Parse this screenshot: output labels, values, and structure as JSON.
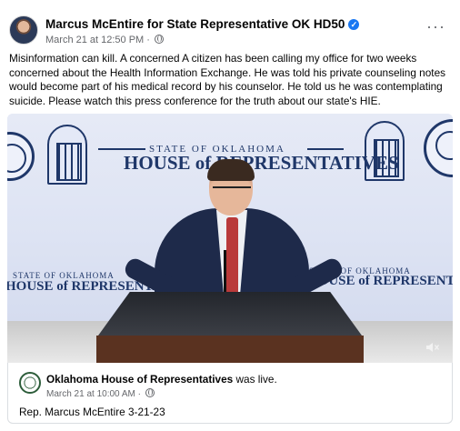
{
  "post": {
    "author": "Marcus McEntire for State Representative OK HD50",
    "verified_icon": "verified-badge-icon",
    "timestamp": "March 21 at 12:50 PM",
    "separator": "·",
    "audience_icon": "globe-icon",
    "more_options": "···",
    "text": "Misinformation can kill. A concerned A citizen has been calling my office for two weeks concerned about the Health Information Exchange. He was told his private counseling notes would become part of his medical record by his counselor. He told us he was contemplating suicide. Please watch this press conference for the truth about our state's HIE."
  },
  "video": {
    "backdrop_small_text": "STATE OF OKLAHOMA",
    "backdrop_big_text": "HOUSE of REPRESENTATIVES",
    "lower_small_text": "STATE OF OKLAHOMA",
    "lower_big_text": "HOUSE of REPRESENTATIVES",
    "mute_icon": "speaker-muted-icon"
  },
  "live_card": {
    "page_name": "Oklahoma House of Representatives",
    "status": "was live.",
    "timestamp": "March 21 at 10:00 AM",
    "separator": "·",
    "caption": "Rep. Marcus McEntire 3-21-23"
  },
  "colors": {
    "link_gray": "#65676b",
    "verified_blue": "#1877f2",
    "house_navy": "#1f3769"
  }
}
